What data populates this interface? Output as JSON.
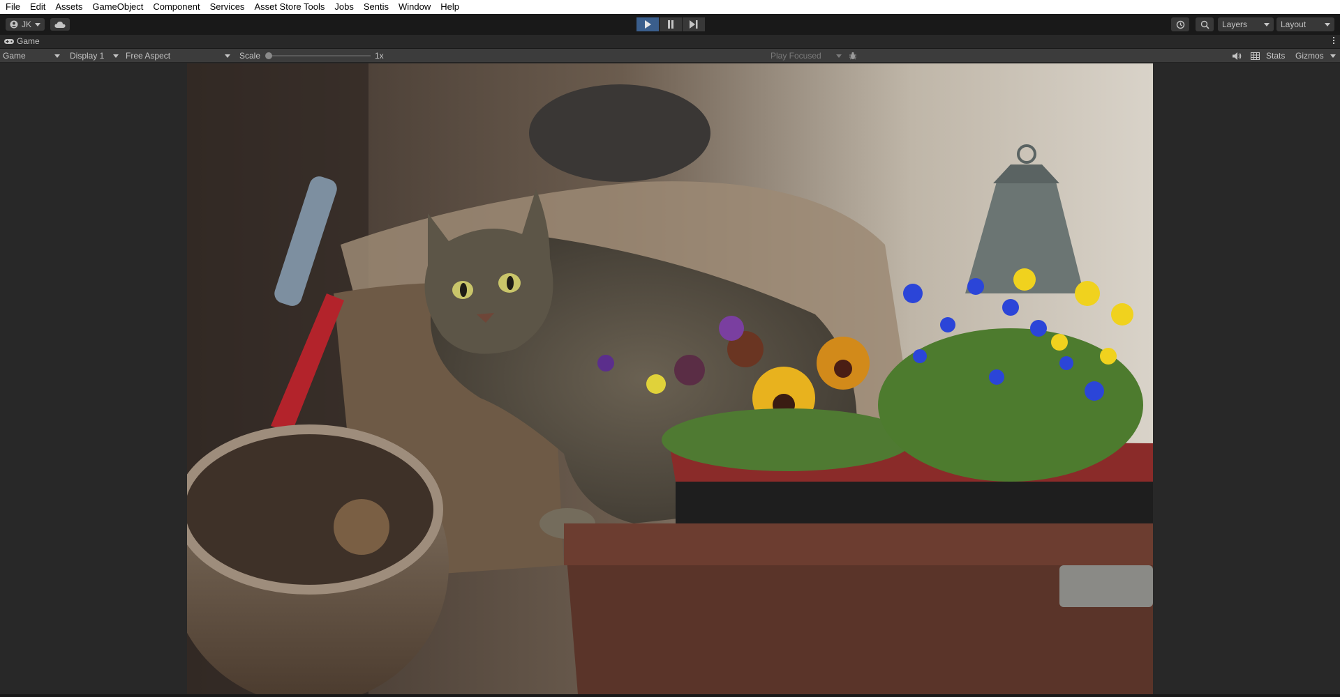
{
  "menubar": {
    "items": [
      "File",
      "Edit",
      "Assets",
      "GameObject",
      "Component",
      "Services",
      "Asset Store Tools",
      "Jobs",
      "Sentis",
      "Window",
      "Help"
    ]
  },
  "toolbar": {
    "account_label": "JK",
    "cloud_icon": "cloud-icon",
    "play_icon": "play-icon",
    "pause_icon": "pause-icon",
    "step_icon": "step-icon",
    "history_icon": "history-icon",
    "search_icon": "search-icon",
    "layers_label": "Layers",
    "layout_label": "Layout",
    "play_active_color": "#3a5e8c"
  },
  "tab": {
    "title": "Game",
    "icon": "gamepad-icon"
  },
  "viewbar": {
    "mode": "Game",
    "display": "Display 1",
    "aspect": "Free Aspect",
    "scale_label": "Scale",
    "scale_value": "1x",
    "scale_fraction": 0.0,
    "play_focused": "Play Focused",
    "stats_label": "Stats",
    "gizmos_label": "Gizmos",
    "audio_icon": "audio-icon",
    "grid_icon": "grid-icon",
    "bug_icon": "bug-icon"
  },
  "game_view": {
    "image_description_icon": "game-render",
    "bg_color": "#282828"
  }
}
